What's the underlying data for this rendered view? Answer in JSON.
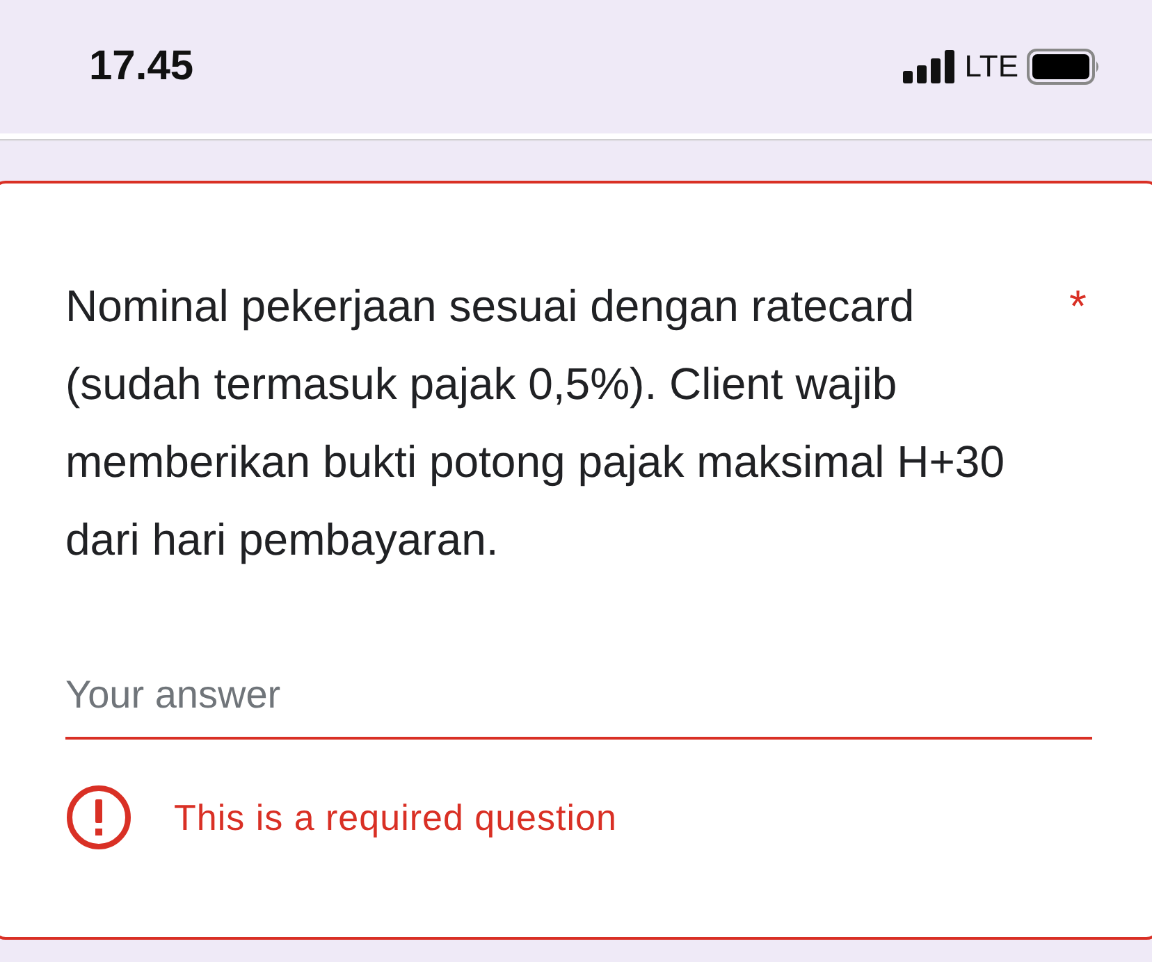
{
  "status_bar": {
    "time": "17.45",
    "network": "LTE"
  },
  "question": {
    "text": "Nominal pekerjaan sesuai dengan ratecard (sudah termasuk pajak 0,5%). Client wajib memberikan bukti potong pajak maksimal H+30 dari hari pembayaran.",
    "required_mark": "*",
    "error": true,
    "answer": {
      "placeholder": "Your answer"
    },
    "error_message": "This is a required question"
  }
}
